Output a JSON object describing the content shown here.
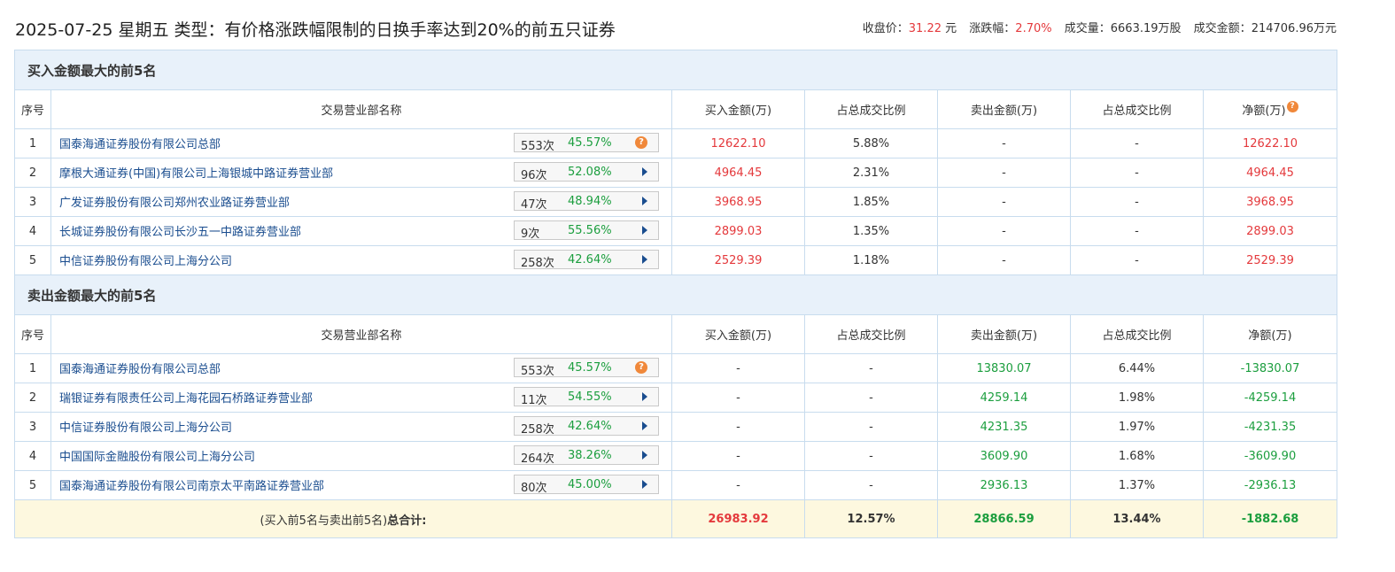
{
  "header": {
    "title": "2025-07-25 星期五 类型：有价格涨跌幅限制的日换手率达到20%的前五只证券",
    "close_label": "收盘价：",
    "close_value": "31.22",
    "close_unit": "元",
    "change_label": "涨跌幅：",
    "change_value": "2.70%",
    "volume_label": "成交量：",
    "volume_value": "6663.19万股",
    "amount_label": "成交金额：",
    "amount_value": "214706.96万元"
  },
  "columns": {
    "rank": "序号",
    "broker": "交易营业部名称",
    "buy": "买入金额(万)",
    "buy_ratio": "占总成交比例",
    "sell": "卖出金额(万)",
    "sell_ratio": "占总成交比例",
    "net": "净额(万)",
    "net_help": "?"
  },
  "buy_section": {
    "title": "买入金额最大的前5名",
    "rows": [
      {
        "rank": "1",
        "name": "国泰海通证券股份有限公司总部",
        "count": "553次",
        "pct": "45.57%",
        "icon": "question-icon",
        "buy": "12622.10",
        "buy_ratio": "5.88%",
        "sell": "-",
        "sell_ratio": "-",
        "net": "12622.10"
      },
      {
        "rank": "2",
        "name": "摩根大通证券(中国)有限公司上海银城中路证券营业部",
        "count": "96次",
        "pct": "52.08%",
        "icon": "arrow-right-icon",
        "buy": "4964.45",
        "buy_ratio": "2.31%",
        "sell": "-",
        "sell_ratio": "-",
        "net": "4964.45"
      },
      {
        "rank": "3",
        "name": "广发证券股份有限公司郑州农业路证券营业部",
        "count": "47次",
        "pct": "48.94%",
        "icon": "arrow-right-icon",
        "buy": "3968.95",
        "buy_ratio": "1.85%",
        "sell": "-",
        "sell_ratio": "-",
        "net": "3968.95"
      },
      {
        "rank": "4",
        "name": "长城证券股份有限公司长沙五一中路证券营业部",
        "count": "9次",
        "pct": "55.56%",
        "icon": "arrow-right-icon",
        "buy": "2899.03",
        "buy_ratio": "1.35%",
        "sell": "-",
        "sell_ratio": "-",
        "net": "2899.03"
      },
      {
        "rank": "5",
        "name": "中信证券股份有限公司上海分公司",
        "count": "258次",
        "pct": "42.64%",
        "icon": "arrow-right-icon",
        "buy": "2529.39",
        "buy_ratio": "1.18%",
        "sell": "-",
        "sell_ratio": "-",
        "net": "2529.39"
      }
    ]
  },
  "sell_section": {
    "title": "卖出金额最大的前5名",
    "rows": [
      {
        "rank": "1",
        "name": "国泰海通证券股份有限公司总部",
        "count": "553次",
        "pct": "45.57%",
        "icon": "question-icon",
        "buy": "-",
        "buy_ratio": "-",
        "sell": "13830.07",
        "sell_ratio": "6.44%",
        "net": "-13830.07"
      },
      {
        "rank": "2",
        "name": "瑞银证券有限责任公司上海花园石桥路证券营业部",
        "count": "11次",
        "pct": "54.55%",
        "icon": "arrow-right-icon",
        "buy": "-",
        "buy_ratio": "-",
        "sell": "4259.14",
        "sell_ratio": "1.98%",
        "net": "-4259.14"
      },
      {
        "rank": "3",
        "name": "中信证券股份有限公司上海分公司",
        "count": "258次",
        "pct": "42.64%",
        "icon": "arrow-right-icon",
        "buy": "-",
        "buy_ratio": "-",
        "sell": "4231.35",
        "sell_ratio": "1.97%",
        "net": "-4231.35"
      },
      {
        "rank": "4",
        "name": "中国国际金融股份有限公司上海分公司",
        "count": "264次",
        "pct": "38.26%",
        "icon": "arrow-right-icon",
        "buy": "-",
        "buy_ratio": "-",
        "sell": "3609.90",
        "sell_ratio": "1.68%",
        "net": "-3609.90"
      },
      {
        "rank": "5",
        "name": "国泰海通证券股份有限公司南京太平南路证券营业部",
        "count": "80次",
        "pct": "45.00%",
        "icon": "arrow-right-icon",
        "buy": "-",
        "buy_ratio": "-",
        "sell": "2936.13",
        "sell_ratio": "1.37%",
        "net": "-2936.13"
      }
    ]
  },
  "total": {
    "label_prefix": "(买入前5名与卖出前5名)",
    "label_bold": "总合计:",
    "buy": "26983.92",
    "buy_ratio": "12.57%",
    "sell": "28866.59",
    "sell_ratio": "13.44%",
    "net": "-1882.68"
  },
  "colors": {
    "positive": "#e4393c",
    "negative": "#1b9e3e",
    "link": "#1a4d8f",
    "section_bg": "#e8f1fa",
    "total_bg": "#fdf8df"
  }
}
